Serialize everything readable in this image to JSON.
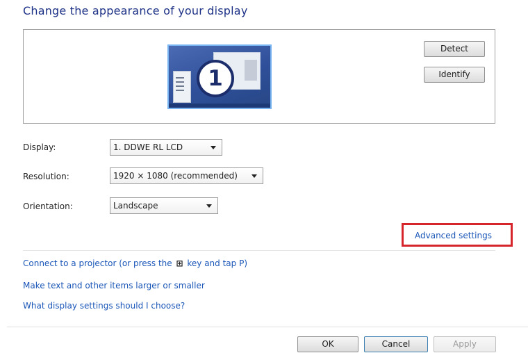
{
  "header": {
    "title": "Change the appearance of your display"
  },
  "preview": {
    "monitor_number": "1",
    "detect_label": "Detect",
    "identify_label": "Identify"
  },
  "settings": {
    "display": {
      "label": "Display:",
      "value": "1. DDWE RL LCD"
    },
    "resolution": {
      "label": "Resolution:",
      "value": "1920 × 1080 (recommended)"
    },
    "orientation": {
      "label": "Orientation:",
      "value": "Landscape"
    }
  },
  "advanced": {
    "link_label": "Advanced settings",
    "highlight_color": "#d6262b"
  },
  "links": {
    "projector_before": "Connect to a projector (or press the",
    "projector_key_icon": "windows-logo-key-icon",
    "projector_after": "key and tap P)",
    "text_size": "Make text and other items larger or smaller",
    "help": "What display settings should I choose?"
  },
  "footer": {
    "ok_label": "OK",
    "cancel_label": "Cancel",
    "apply_label": "Apply"
  },
  "colors": {
    "title": "#1e3287",
    "link": "#1a56b8",
    "monitor_bg": "#2f4f9a"
  }
}
